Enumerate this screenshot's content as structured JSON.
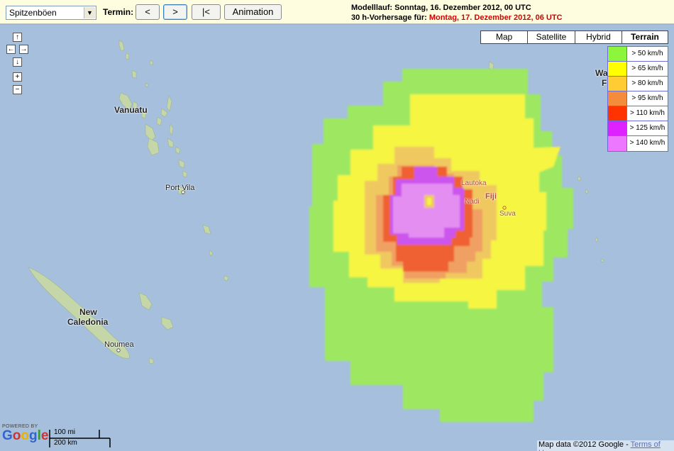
{
  "toolbar": {
    "parameter_select": "Spitzenböen",
    "termin_label": "Termin:",
    "btn_prev": "<",
    "btn_next": ">",
    "btn_first": "|<",
    "btn_animation": "Animation",
    "model_run": "Modelllauf: Sonntag, 16. Dezember 2012, 00 UTC",
    "forecast_prefix": "30 h-Vorhersage für: ",
    "forecast_date": "Montag, 17. Dezember 2012, 06 UTC"
  },
  "nav": {
    "up": "↑",
    "left": "←",
    "right": "→",
    "down": "↓",
    "zoom_in": "+",
    "zoom_out": "−"
  },
  "map_types": [
    "Map",
    "Satellite",
    "Hybrid",
    "Terrain"
  ],
  "selected_map_type": "Terrain",
  "legend": [
    {
      "label": "> 50 km/h",
      "color": "#8cf53c"
    },
    {
      "label": "> 65 km/h",
      "color": "#ffff00"
    },
    {
      "label": "> 80 km/h",
      "color": "#ffcc33"
    },
    {
      "label": "> 95 km/h",
      "color": "#f58c3c"
    },
    {
      "label": "> 110 km/h",
      "color": "#ff3300"
    },
    {
      "label": "> 125 km/h",
      "color": "#dd22ff"
    },
    {
      "label": "> 140 km/h",
      "color": "#ee77ff"
    }
  ],
  "places": {
    "vanuatu": "Vanuatu",
    "port_vila": "Port Vila",
    "new_caledonia_1": "New",
    "new_caledonia_2": "Caledonia",
    "noumea": "Noumea",
    "lautoka": "Lautoka",
    "nadi": "Nadi",
    "fiji": "Fiji",
    "suva": "Suva",
    "wallis_partial_1": "Wa",
    "wallis_partial_2": "F"
  },
  "branding": {
    "powered_by": "POWERED BY",
    "logo": "Google"
  },
  "scale": {
    "miles": "100 mi",
    "km": "200 km"
  },
  "attribution": {
    "text": "Map data ©2012 Google - ",
    "terms": "Terms of Use"
  }
}
